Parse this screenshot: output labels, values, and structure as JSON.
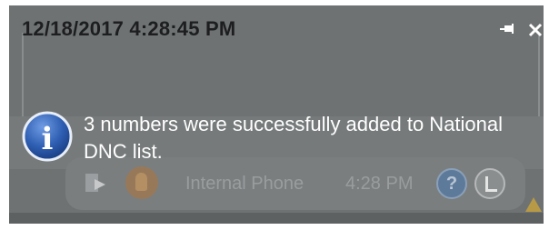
{
  "toast": {
    "timestamp": "12/18/2017 4:28:45 PM",
    "message": "3 numbers were successfully added to National DNC list.",
    "pin_icon": "pin-icon",
    "close_icon": "close-icon",
    "info_icon": "info-icon",
    "info_glyph": "i"
  },
  "background_call": {
    "caller_label": "Internal Phone",
    "time": "4:28 PM",
    "help_glyph": "?",
    "icons": [
      "phone-transfer-icon",
      "avatar-icon",
      "help-icon",
      "status-icon",
      "warning-icon"
    ]
  },
  "colors": {
    "window_background": "#6f7273",
    "info_blue": "#2f5fb3",
    "timestamp_text": "#1c1e1f",
    "message_text": "#ffffff"
  }
}
